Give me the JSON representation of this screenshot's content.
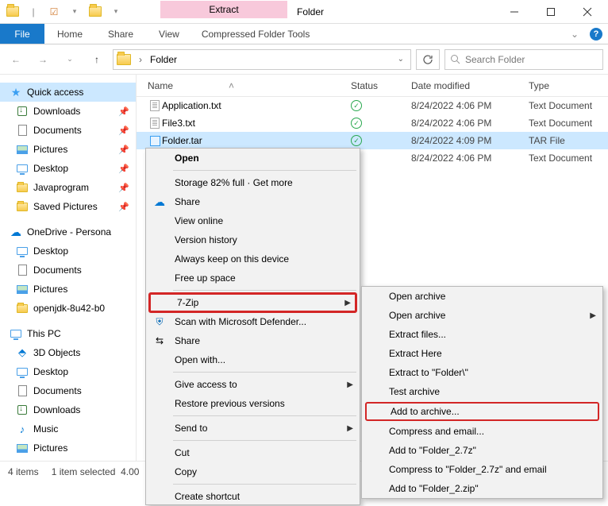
{
  "titlebar": {
    "extract": "Extract",
    "title": "Folder"
  },
  "ribbon": {
    "file": "File",
    "home": "Home",
    "share": "Share",
    "view": "View",
    "cft": "Compressed Folder Tools"
  },
  "nav": {
    "path": "Folder",
    "search_placeholder": "Search Folder"
  },
  "sidebar": {
    "quick_access": "Quick access",
    "qa_items": [
      {
        "label": "Downloads",
        "icon": "dl"
      },
      {
        "label": "Documents",
        "icon": "doc"
      },
      {
        "label": "Pictures",
        "icon": "pic"
      },
      {
        "label": "Desktop",
        "icon": "monitor"
      },
      {
        "label": "Javaprogram",
        "icon": "folder"
      },
      {
        "label": "Saved Pictures",
        "icon": "folder"
      }
    ],
    "onedrive": "OneDrive - Persona",
    "od_items": [
      {
        "label": "Desktop",
        "icon": "monitor"
      },
      {
        "label": "Documents",
        "icon": "doc"
      },
      {
        "label": "Pictures",
        "icon": "pic"
      },
      {
        "label": "openjdk-8u42-b0",
        "icon": "folder"
      }
    ],
    "this_pc": "This PC",
    "pc_items": [
      {
        "label": "3D Objects",
        "icon": "3d"
      },
      {
        "label": "Desktop",
        "icon": "monitor"
      },
      {
        "label": "Documents",
        "icon": "doc"
      },
      {
        "label": "Downloads",
        "icon": "dl"
      },
      {
        "label": "Music",
        "icon": "music"
      },
      {
        "label": "Pictures",
        "icon": "pic"
      }
    ]
  },
  "columns": {
    "name": "Name",
    "status": "Status",
    "date": "Date modified",
    "type": "Type"
  },
  "files": [
    {
      "name": "Application.txt",
      "icon": "txt",
      "status": "ok",
      "date": "8/24/2022 4:06 PM",
      "type": "Text Document",
      "sel": false
    },
    {
      "name": "File3.txt",
      "icon": "txt",
      "status": "ok",
      "date": "8/24/2022 4:06 PM",
      "type": "Text Document",
      "sel": false
    },
    {
      "name": "Folder.tar",
      "icon": "tar",
      "status": "ok",
      "date": "8/24/2022 4:09 PM",
      "type": "TAR File",
      "sel": true
    },
    {
      "name": "",
      "icon": "",
      "status": "",
      "date": "8/24/2022 4:06 PM",
      "type": "Text Document",
      "sel": false
    }
  ],
  "ctx1": {
    "open": "Open",
    "storage": "Storage 82% full · Get more",
    "share": "Share",
    "view_online": "View online",
    "version_history": "Version history",
    "always_keep": "Always keep on this device",
    "free_up": "Free up space",
    "seven_zip": "7-Zip",
    "defender": "Scan with Microsoft Defender...",
    "share2": "Share",
    "open_with": "Open with...",
    "give_access": "Give access to",
    "restore": "Restore previous versions",
    "send_to": "Send to",
    "cut": "Cut",
    "copy": "Copy",
    "create_shortcut": "Create shortcut"
  },
  "ctx2": {
    "items": [
      "Open archive",
      "Open archive",
      "Extract files...",
      "Extract Here",
      "Extract to \"Folder\\\"",
      "Test archive",
      "Add to archive...",
      "Compress and email...",
      "Add to \"Folder_2.7z\"",
      "Compress to \"Folder_2.7z\" and email",
      "Add to \"Folder_2.zip\""
    ],
    "submenu_index": 1,
    "highlight_index": 6
  },
  "status": {
    "items": "4 items",
    "selected": "1 item selected",
    "size": "4.00"
  }
}
